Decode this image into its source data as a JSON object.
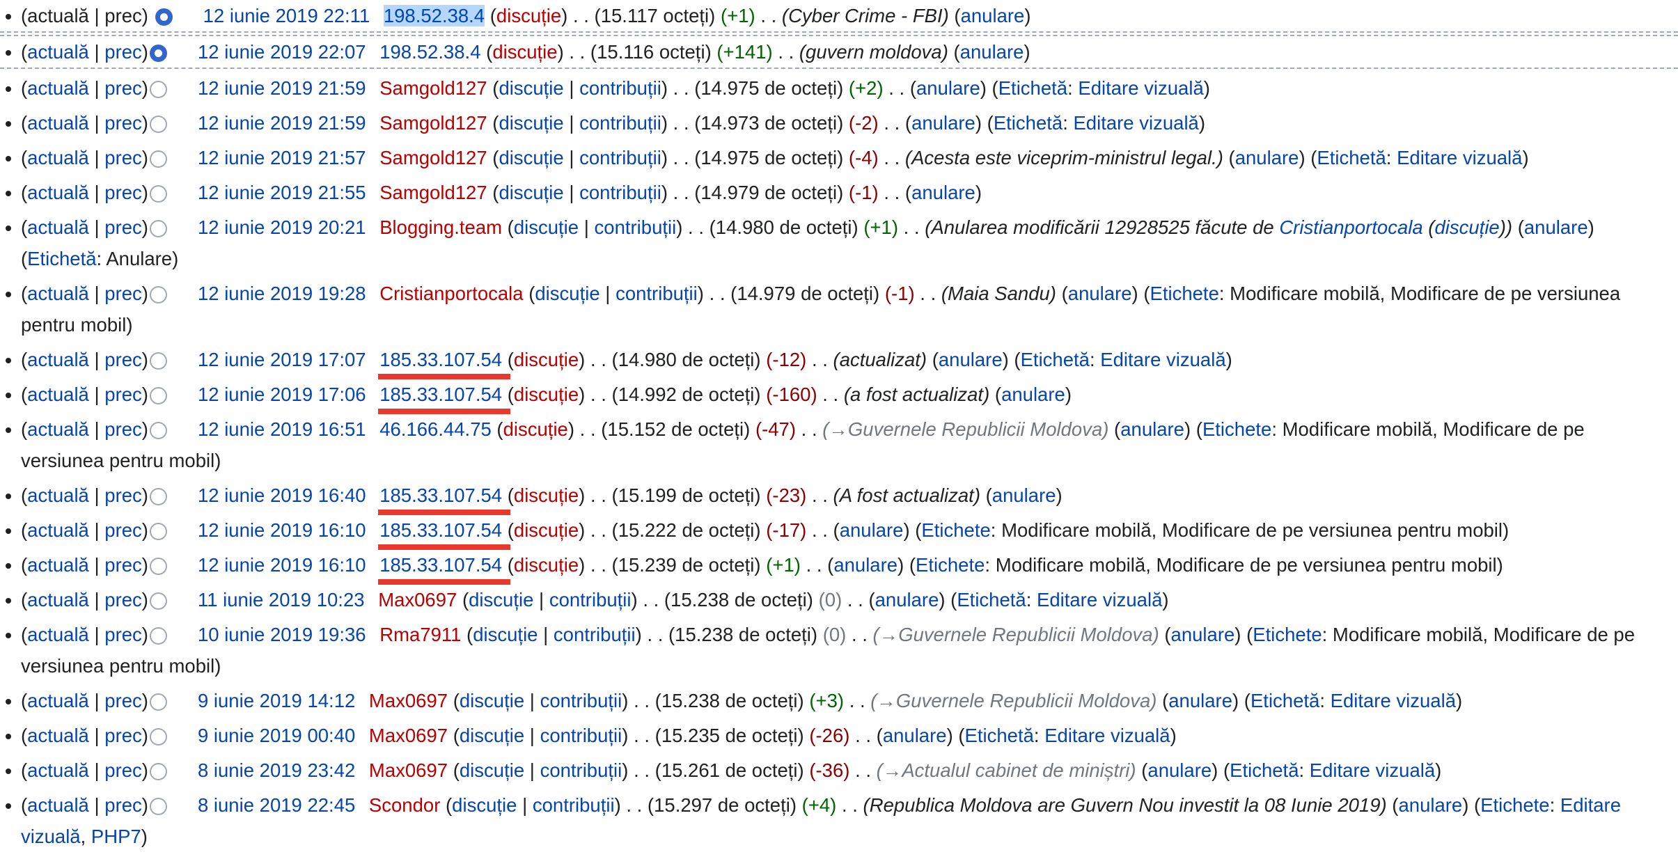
{
  "colors": {
    "link": "#0645ad",
    "redlink": "#ba0000",
    "pos": "#006400",
    "neg": "#8b0000",
    "zero": "#72777d",
    "selected": "#3366cc",
    "underline": "#e8392c"
  },
  "labels": {
    "cur": "actuală",
    "prev": "prec",
    "talk": "discuție",
    "contribs": "contribuții",
    "undo": "anulare",
    "tag": "Etichetă",
    "tags": "Etichete",
    "dots": ". .",
    "pipe": "|"
  },
  "rows": [
    {
      "date": "12 iunie 2019 22:11",
      "user": "198.52.38.4",
      "size": "15.117 octeți",
      "diff": "+1",
      "comment": "Cyber Crime - FBI",
      "tag1": "",
      "tag2": ""
    },
    {
      "date": "12 iunie 2019 22:07",
      "user": "198.52.38.4",
      "size": "15.116 octeți",
      "diff": "+141",
      "comment": "guvern moldova",
      "tag1": "",
      "tag2": ""
    },
    {
      "date": "12 iunie 2019 21:59",
      "user": "Samgold127",
      "size": "14.975 de octeți",
      "diff": "+2",
      "tag1": "Editare vizuală"
    },
    {
      "date": "12 iunie 2019 21:59",
      "user": "Samgold127",
      "size": "14.973 de octeți",
      "diff": "-2",
      "tag1": "Editare vizuală"
    },
    {
      "date": "12 iunie 2019 21:57",
      "user": "Samgold127",
      "size": "14.975 de octeți",
      "diff": "-4",
      "comment": "Acesta este viceprim-ministrul legal.",
      "tag1": "Editare vizuală"
    },
    {
      "date": "12 iunie 2019 21:55",
      "user": "Samgold127",
      "size": "14.979 de octeți",
      "diff": "-1"
    },
    {
      "date": "12 iunie 2019 20:21",
      "user": "Blogging.team",
      "size": "14.980 de octeți",
      "diff": "+1",
      "comment_pre": "Anularea modificării 12928525 făcute de ",
      "comment_user": "Cristianportocala",
      "comment_talk": "discuție",
      "tag1": "Anulare"
    },
    {
      "date": "12 iunie 2019 19:28",
      "user": "Cristianportocala",
      "size": "14.979 de octeți",
      "diff": "-1",
      "comment": "Maia Sandu",
      "tag1": "Modificare mobilă, Modificare de pe versiunea pentru mobil"
    },
    {
      "date": "12 iunie 2019 17:07",
      "user": "185.33.107.54",
      "size": "14.980 de octeți",
      "diff": "-12",
      "comment": "actualizat",
      "tag1": "Editare vizuală"
    },
    {
      "date": "12 iunie 2019 17:06",
      "user": "185.33.107.54",
      "size": "14.992 de octeți",
      "diff": "-160",
      "comment": "a fost actualizat"
    },
    {
      "date": "12 iunie 2019 16:51",
      "user": "46.166.44.75",
      "size": "15.152 de octeți",
      "diff": "-47",
      "comment": "→Guvernele Republicii Moldova",
      "tag1": "Modificare mobilă, Modificare de pe versiunea pentru mobil"
    },
    {
      "date": "12 iunie 2019 16:40",
      "user": "185.33.107.54",
      "size": "15.199 de octeți",
      "diff": "-23",
      "comment": "A fost actualizat"
    },
    {
      "date": "12 iunie 2019 16:10",
      "user": "185.33.107.54",
      "size": "15.222 de octeți",
      "diff": "-17",
      "tag1": "Modificare mobilă, Modificare de pe versiunea pentru mobil"
    },
    {
      "date": "12 iunie 2019 16:10",
      "user": "185.33.107.54",
      "size": "15.239 de octeți",
      "diff": "+1",
      "tag1": "Modificare mobilă, Modificare de pe versiunea pentru mobil"
    },
    {
      "date": "11 iunie 2019 10:23",
      "user": "Max0697",
      "size": "15.238 de octeți",
      "diff": "0",
      "tag1": "Editare vizuală"
    },
    {
      "date": "10 iunie 2019 19:36",
      "user": "Rma7911",
      "size": "15.238 de octeți",
      "diff": "0",
      "comment": "→Guvernele Republicii Moldova",
      "tag1": "Modificare mobilă, Modificare de pe versiunea pentru mobil"
    },
    {
      "date": "9 iunie 2019 14:12",
      "user": "Max0697",
      "size": "15.238 de octeți",
      "diff": "+3",
      "comment": "→Guvernele Republicii Moldova",
      "tag1": "Editare vizuală"
    },
    {
      "date": "9 iunie 2019 00:40",
      "user": "Max0697",
      "size": "15.235 de octeți",
      "diff": "-26",
      "tag1": "Editare vizuală"
    },
    {
      "date": "8 iunie 2019 23:42",
      "user": "Max0697",
      "size": "15.261 de octeți",
      "diff": "-36",
      "comment": "→Actualul cabinet de miniștri",
      "tag1": "Editare vizuală"
    },
    {
      "date": "8 iunie 2019 22:45",
      "user": "Scondor",
      "size": "15.297 de octeți",
      "diff": "+4",
      "comment": "Republica Moldova are Guvern Nou investit la 08 Iunie 2019",
      "tag1": "Editare vizuală",
      "tag2": "PHP7"
    }
  ]
}
